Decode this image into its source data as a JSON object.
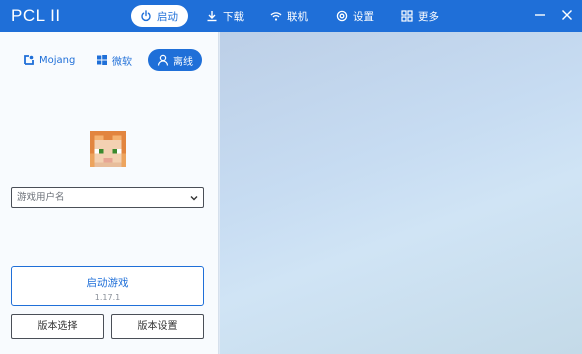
{
  "app": {
    "title": "PCL II"
  },
  "nav": {
    "launch": "启动",
    "download": "下载",
    "online": "联机",
    "settings": "设置",
    "more": "更多"
  },
  "account_tabs": {
    "mojang": "Mojang",
    "microsoft": "微软",
    "offline": "离线"
  },
  "login": {
    "username_placeholder": "游戏用户名",
    "launch_label": "启动游戏",
    "launch_version": "1.17.1",
    "version_select": "版本选择",
    "version_settings": "版本设置"
  },
  "colors": {
    "accent": "#1f6fd8",
    "panel": "#f8fbfe"
  },
  "icons": {
    "launch": "power-icon",
    "download": "download-icon",
    "online": "wifi-icon",
    "settings": "gear-icon",
    "more": "grid-icon",
    "mojang": "mojang-icon",
    "microsoft": "windows-icon",
    "offline": "user-icon"
  }
}
